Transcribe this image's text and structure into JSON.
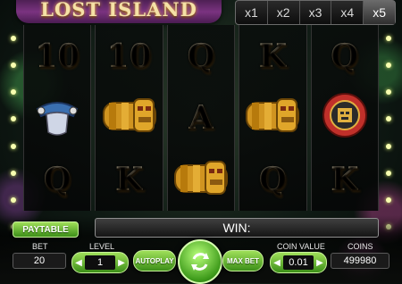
{
  "game": {
    "title": "LOST ISLAND"
  },
  "multipliers": [
    "x1",
    "x2",
    "x3",
    "x4",
    "x5"
  ],
  "reels": [
    [
      "10",
      "mask",
      "Q"
    ],
    [
      "10",
      "idol",
      "K"
    ],
    [
      "Q",
      "A",
      "idol"
    ],
    [
      "K",
      "idol",
      "Q"
    ],
    [
      "Q",
      "medallion",
      "K"
    ]
  ],
  "symbol_icons": {
    "mask": "stone-mask-icon",
    "idol": "golden-idol-icon",
    "medallion": "medallion-icon"
  },
  "controls": {
    "paytable": "PAYTABLE",
    "win_label": "WIN:",
    "bet_label": "BET",
    "bet_value": "20",
    "level_label": "LEVEL",
    "level_value": "1",
    "autoplay": "AUTOPLAY",
    "max_bet": "MAX BET",
    "coin_value_label": "COIN VALUE",
    "coin_value": "0.01",
    "coins_label": "COINS",
    "coins_value": "499980"
  },
  "colors": {
    "accent": "#5fb82a",
    "title_gold": "#f5e1a6",
    "frame": "#7a3380"
  }
}
